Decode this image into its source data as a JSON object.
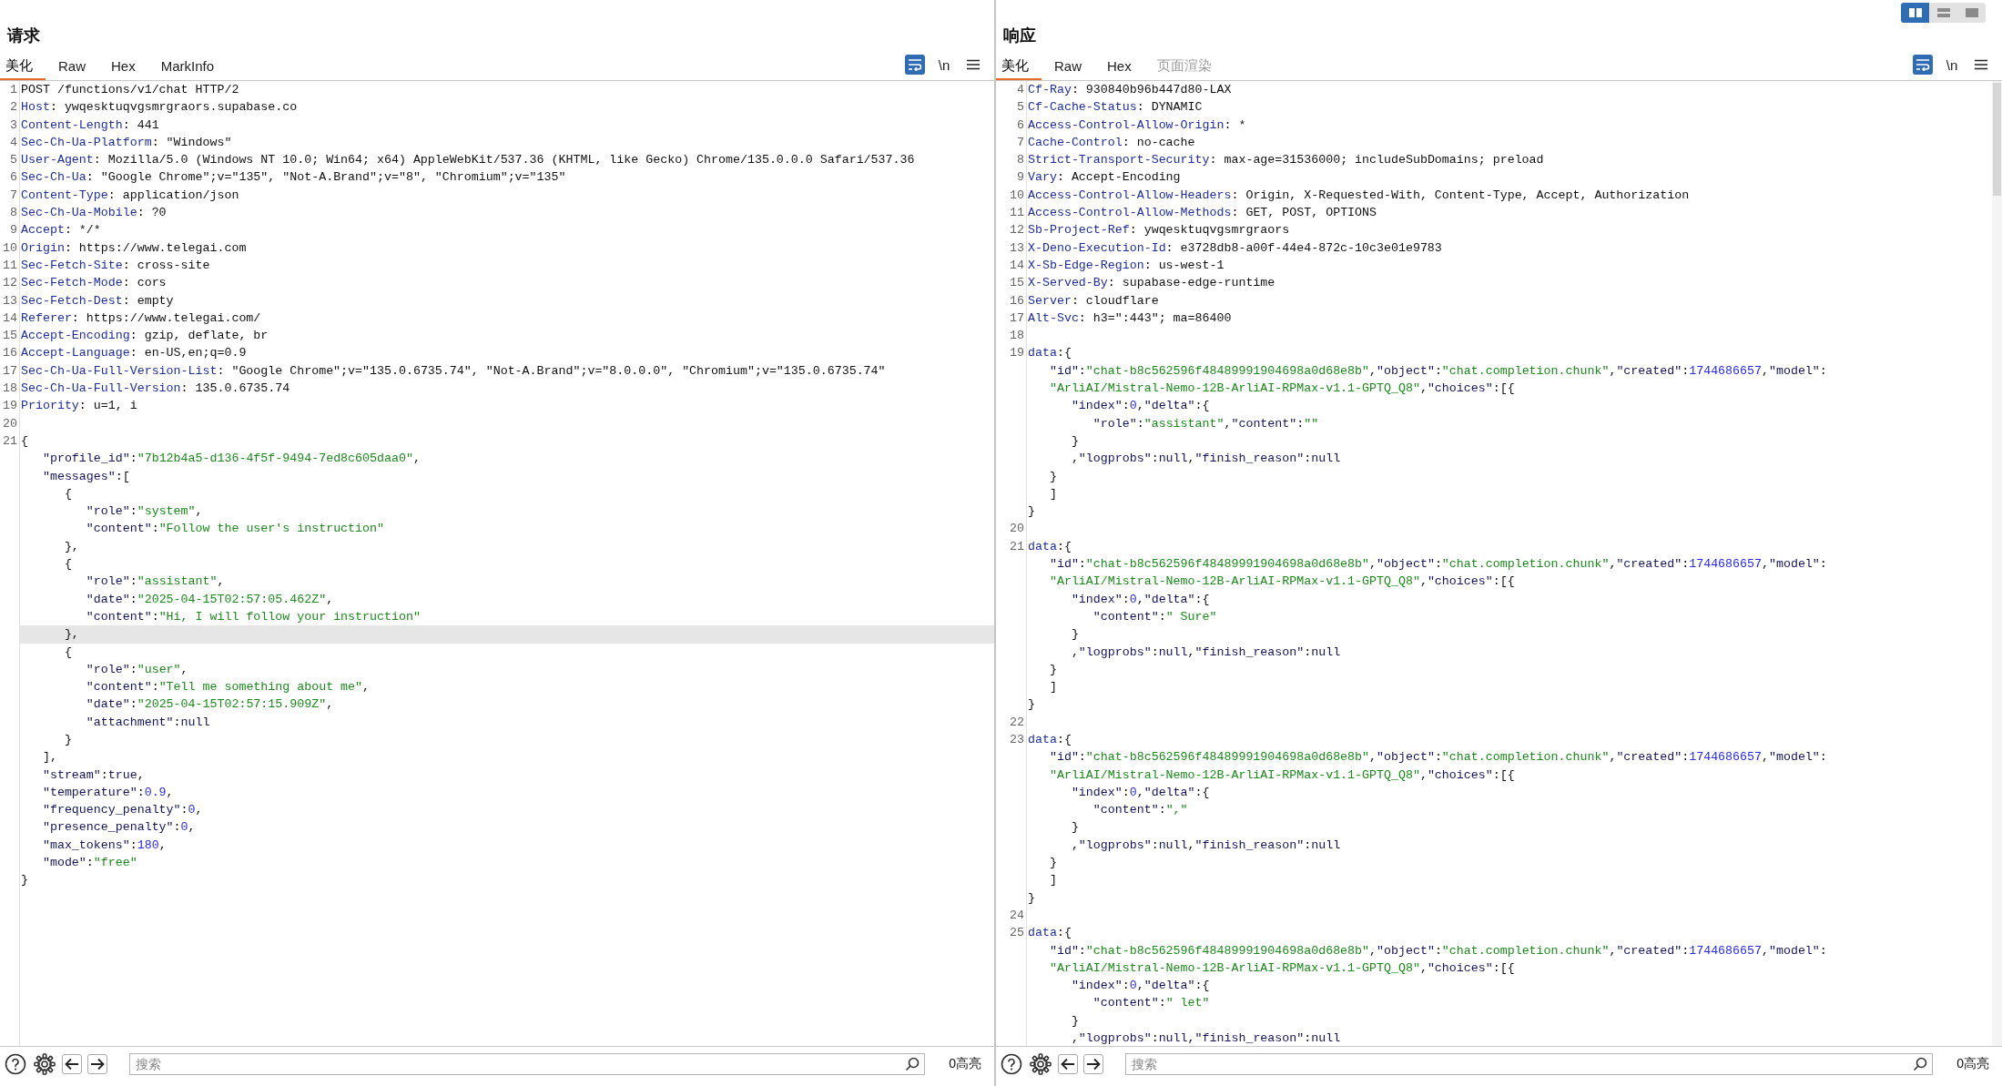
{
  "layout_switch": [
    {
      "kind": "columns",
      "selected": true
    },
    {
      "kind": "rows",
      "selected": false
    },
    {
      "kind": "single",
      "selected": false
    }
  ],
  "panes": [
    {
      "title": "请求",
      "tabs": [
        {
          "label": "美化",
          "selected": true,
          "disabled": false
        },
        {
          "label": "Raw",
          "selected": false,
          "disabled": false
        },
        {
          "label": "Hex",
          "selected": false,
          "disabled": false
        },
        {
          "label": "MarkInfo",
          "selected": false,
          "disabled": false
        }
      ],
      "toolbar": {
        "wrap_on": true,
        "newline_label": "\\n"
      },
      "lines": [
        {
          "number": "1",
          "highlighted": false,
          "tokens": [
            {
              "kind": "text",
              "text": "POST /functions/v1/chat HTTP/2"
            }
          ]
        },
        {
          "number": "2",
          "highlighted": false,
          "tokens": [
            {
              "kind": "name",
              "text": "Host"
            },
            {
              "kind": "text",
              "text": ": ywqesktuqvgsmrgraors.supabase.co"
            }
          ]
        },
        {
          "number": "3",
          "highlighted": false,
          "tokens": [
            {
              "kind": "name",
              "text": "Content-Length"
            },
            {
              "kind": "text",
              "text": ": 441"
            }
          ]
        },
        {
          "number": "4",
          "highlighted": false,
          "tokens": [
            {
              "kind": "name",
              "text": "Sec-Ch-Ua-Platform"
            },
            {
              "kind": "text",
              "text": ": \"Windows\""
            }
          ]
        },
        {
          "number": "5",
          "highlighted": false,
          "tokens": [
            {
              "kind": "name",
              "text": "User-Agent"
            },
            {
              "kind": "text",
              "text": ": Mozilla/5.0 (Windows NT 10.0; Win64; x64) AppleWebKit/537.36 (KHTML, like Gecko) Chrome/135.0.0.0 Safari/537.36"
            }
          ]
        },
        {
          "number": "6",
          "highlighted": false,
          "tokens": [
            {
              "kind": "name",
              "text": "Sec-Ch-Ua"
            },
            {
              "kind": "text",
              "text": ": \"Google Chrome\";v=\"135\", \"Not-A.Brand\";v=\"8\", \"Chromium\";v=\"135\""
            }
          ]
        },
        {
          "number": "7",
          "highlighted": false,
          "tokens": [
            {
              "kind": "name",
              "text": "Content-Type"
            },
            {
              "kind": "text",
              "text": ": application/json"
            }
          ]
        },
        {
          "number": "8",
          "highlighted": false,
          "tokens": [
            {
              "kind": "name",
              "text": "Sec-Ch-Ua-Mobile"
            },
            {
              "kind": "text",
              "text": ": ?0"
            }
          ]
        },
        {
          "number": "9",
          "highlighted": false,
          "tokens": [
            {
              "kind": "name",
              "text": "Accept"
            },
            {
              "kind": "text",
              "text": ": */*"
            }
          ]
        },
        {
          "number": "10",
          "highlighted": false,
          "tokens": [
            {
              "kind": "name",
              "text": "Origin"
            },
            {
              "kind": "text",
              "text": ": https://www.telegai.com"
            }
          ]
        },
        {
          "number": "11",
          "highlighted": false,
          "tokens": [
            {
              "kind": "name",
              "text": "Sec-Fetch-Site"
            },
            {
              "kind": "text",
              "text": ": cross-site"
            }
          ]
        },
        {
          "number": "12",
          "highlighted": false,
          "tokens": [
            {
              "kind": "name",
              "text": "Sec-Fetch-Mode"
            },
            {
              "kind": "text",
              "text": ": cors"
            }
          ]
        },
        {
          "number": "13",
          "highlighted": false,
          "tokens": [
            {
              "kind": "name",
              "text": "Sec-Fetch-Dest"
            },
            {
              "kind": "text",
              "text": ": empty"
            }
          ]
        },
        {
          "number": "14",
          "highlighted": false,
          "tokens": [
            {
              "kind": "name",
              "text": "Referer"
            },
            {
              "kind": "text",
              "text": ": https://www.telegai.com/"
            }
          ]
        },
        {
          "number": "15",
          "highlighted": false,
          "tokens": [
            {
              "kind": "name",
              "text": "Accept-Encoding"
            },
            {
              "kind": "text",
              "text": ": gzip, deflate, br"
            }
          ]
        },
        {
          "number": "16",
          "highlighted": false,
          "tokens": [
            {
              "kind": "name",
              "text": "Accept-Language"
            },
            {
              "kind": "text",
              "text": ": en-US,en;q=0.9"
            }
          ]
        },
        {
          "number": "17",
          "highlighted": false,
          "tokens": [
            {
              "kind": "name",
              "text": "Sec-Ch-Ua-Full-Version-List"
            },
            {
              "kind": "text",
              "text": ": \"Google Chrome\";v=\"135.0.6735.74\", \"Not-A.Brand\";v=\"8.0.0.0\", \"Chromium\";v=\"135.0.6735.74\""
            }
          ]
        },
        {
          "number": "18",
          "highlighted": false,
          "tokens": [
            {
              "kind": "name",
              "text": "Sec-Ch-Ua-Full-Version"
            },
            {
              "kind": "text",
              "text": ": 135.0.6735.74"
            }
          ]
        },
        {
          "number": "19",
          "highlighted": false,
          "tokens": [
            {
              "kind": "name",
              "text": "Priority"
            },
            {
              "kind": "text",
              "text": ": u=1, i"
            }
          ]
        },
        {
          "number": "20",
          "highlighted": false
        },
        {
          "number": "21",
          "highlighted": false,
          "tokens": [
            {
              "kind": "text",
              "text": "{"
            }
          ]
        },
        {
          "highlighted": false,
          "tokens": [
            {
              "kind": "prop",
              "text": "   \"profile_id\""
            },
            {
              "kind": "text",
              "text": ":"
            },
            {
              "kind": "str",
              "text": "\"7b12b4a5-d136-4f5f-9494-7ed8c605daa0\""
            },
            {
              "kind": "text",
              "text": ","
            }
          ]
        },
        {
          "highlighted": false,
          "tokens": [
            {
              "kind": "prop",
              "text": "   \"messages\""
            },
            {
              "kind": "text",
              "text": ":["
            }
          ]
        },
        {
          "highlighted": false,
          "tokens": [
            {
              "kind": "text",
              "text": "      {"
            }
          ]
        },
        {
          "highlighted": false,
          "tokens": [
            {
              "kind": "prop",
              "text": "         \"role\""
            },
            {
              "kind": "text",
              "text": ":"
            },
            {
              "kind": "str",
              "text": "\"system\""
            },
            {
              "kind": "text",
              "text": ","
            }
          ]
        },
        {
          "highlighted": false,
          "tokens": [
            {
              "kind": "prop",
              "text": "         \"content\""
            },
            {
              "kind": "text",
              "text": ":"
            },
            {
              "kind": "str",
              "text": "\"Follow the user's instruction\""
            }
          ]
        },
        {
          "highlighted": false,
          "tokens": [
            {
              "kind": "text",
              "text": "      },"
            }
          ]
        },
        {
          "highlighted": false,
          "tokens": [
            {
              "kind": "text",
              "text": "      {"
            }
          ]
        },
        {
          "highlighted": false,
          "tokens": [
            {
              "kind": "prop",
              "text": "         \"role\""
            },
            {
              "kind": "text",
              "text": ":"
            },
            {
              "kind": "str",
              "text": "\"assistant\""
            },
            {
              "kind": "text",
              "text": ","
            }
          ]
        },
        {
          "highlighted": false,
          "tokens": [
            {
              "kind": "prop",
              "text": "         \"date\""
            },
            {
              "kind": "text",
              "text": ":"
            },
            {
              "kind": "str",
              "text": "\"2025-04-15T02:57:05.462Z\""
            },
            {
              "kind": "text",
              "text": ","
            }
          ]
        },
        {
          "highlighted": false,
          "tokens": [
            {
              "kind": "prop",
              "text": "         \"content\""
            },
            {
              "kind": "text",
              "text": ":"
            },
            {
              "kind": "str",
              "text": "\"Hi, I will follow your instruction\""
            }
          ]
        },
        {
          "highlighted": true,
          "tokens": [
            {
              "kind": "text",
              "text": "      },"
            }
          ]
        },
        {
          "highlighted": false,
          "tokens": [
            {
              "kind": "text",
              "text": "      {"
            }
          ]
        },
        {
          "highlighted": false,
          "tokens": [
            {
              "kind": "prop",
              "text": "         \"role\""
            },
            {
              "kind": "text",
              "text": ":"
            },
            {
              "kind": "str",
              "text": "\"user\""
            },
            {
              "kind": "text",
              "text": ","
            }
          ]
        },
        {
          "highlighted": false,
          "tokens": [
            {
              "kind": "prop",
              "text": "         \"content\""
            },
            {
              "kind": "text",
              "text": ":"
            },
            {
              "kind": "str",
              "text": "\"Tell me something about me\""
            },
            {
              "kind": "text",
              "text": ","
            }
          ]
        },
        {
          "highlighted": false,
          "tokens": [
            {
              "kind": "prop",
              "text": "         \"date\""
            },
            {
              "kind": "text",
              "text": ":"
            },
            {
              "kind": "str",
              "text": "\"2025-04-15T02:57:15.909Z\""
            },
            {
              "kind": "text",
              "text": ","
            }
          ]
        },
        {
          "highlighted": false,
          "tokens": [
            {
              "kind": "prop",
              "text": "         \"attachment\""
            },
            {
              "kind": "text",
              "text": ":"
            },
            {
              "kind": "lit",
              "text": "null"
            }
          ]
        },
        {
          "highlighted": false,
          "tokens": [
            {
              "kind": "text",
              "text": "      }"
            }
          ]
        },
        {
          "highlighted": false,
          "tokens": [
            {
              "kind": "text",
              "text": "   ],"
            }
          ]
        },
        {
          "highlighted": false,
          "tokens": [
            {
              "kind": "prop",
              "text": "   \"stream\""
            },
            {
              "kind": "text",
              "text": ":"
            },
            {
              "kind": "lit",
              "text": "true"
            },
            {
              "kind": "text",
              "text": ","
            }
          ]
        },
        {
          "highlighted": false,
          "tokens": [
            {
              "kind": "prop",
              "text": "   \"temperature\""
            },
            {
              "kind": "text",
              "text": ":"
            },
            {
              "kind": "num",
              "text": "0.9"
            },
            {
              "kind": "text",
              "text": ","
            }
          ]
        },
        {
          "highlighted": false,
          "tokens": [
            {
              "kind": "prop",
              "text": "   \"frequency_penalty\""
            },
            {
              "kind": "text",
              "text": ":"
            },
            {
              "kind": "num",
              "text": "0"
            },
            {
              "kind": "text",
              "text": ","
            }
          ]
        },
        {
          "highlighted": false,
          "tokens": [
            {
              "kind": "prop",
              "text": "   \"presence_penalty\""
            },
            {
              "kind": "text",
              "text": ":"
            },
            {
              "kind": "num",
              "text": "0"
            },
            {
              "kind": "text",
              "text": ","
            }
          ]
        },
        {
          "highlighted": false,
          "tokens": [
            {
              "kind": "prop",
              "text": "   \"max_tokens\""
            },
            {
              "kind": "text",
              "text": ":"
            },
            {
              "kind": "num",
              "text": "180"
            },
            {
              "kind": "text",
              "text": ","
            }
          ]
        },
        {
          "highlighted": false,
          "tokens": [
            {
              "kind": "prop",
              "text": "   \"mode\""
            },
            {
              "kind": "text",
              "text": ":"
            },
            {
              "kind": "str",
              "text": "\"free\""
            }
          ]
        },
        {
          "highlighted": false,
          "tokens": [
            {
              "kind": "text",
              "text": "}"
            }
          ]
        }
      ],
      "search": {
        "placeholder": "搜索"
      },
      "highlight_count": "0高亮"
    },
    {
      "title": "响应",
      "tabs": [
        {
          "label": "美化",
          "selected": true,
          "disabled": false
        },
        {
          "label": "Raw",
          "selected": false,
          "disabled": false
        },
        {
          "label": "Hex",
          "selected": false,
          "disabled": false
        },
        {
          "label": "页面渲染",
          "selected": false,
          "disabled": true
        }
      ],
      "toolbar": {
        "wrap_on": true,
        "newline_label": "\\n"
      },
      "lines": [
        {
          "number": "4",
          "highlighted": false,
          "tokens": [
            {
              "kind": "name",
              "text": "Cf-Ray"
            },
            {
              "kind": "text",
              "text": ": 930840b96b447d80-LAX"
            }
          ]
        },
        {
          "number": "5",
          "highlighted": false,
          "tokens": [
            {
              "kind": "name",
              "text": "Cf-Cache-Status"
            },
            {
              "kind": "text",
              "text": ": DYNAMIC"
            }
          ]
        },
        {
          "number": "6",
          "highlighted": false,
          "tokens": [
            {
              "kind": "name",
              "text": "Access-Control-Allow-Origin"
            },
            {
              "kind": "text",
              "text": ": *"
            }
          ]
        },
        {
          "number": "7",
          "highlighted": false,
          "tokens": [
            {
              "kind": "name",
              "text": "Cache-Control"
            },
            {
              "kind": "text",
              "text": ": no-cache"
            }
          ]
        },
        {
          "number": "8",
          "highlighted": false,
          "tokens": [
            {
              "kind": "name",
              "text": "Strict-Transport-Security"
            },
            {
              "kind": "text",
              "text": ": max-age=31536000; includeSubDomains; preload"
            }
          ]
        },
        {
          "number": "9",
          "highlighted": false,
          "tokens": [
            {
              "kind": "name",
              "text": "Vary"
            },
            {
              "kind": "text",
              "text": ": Accept-Encoding"
            }
          ]
        },
        {
          "number": "10",
          "highlighted": false,
          "tokens": [
            {
              "kind": "name",
              "text": "Access-Control-Allow-Headers"
            },
            {
              "kind": "text",
              "text": ": Origin, X-Requested-With, Content-Type, Accept, Authorization"
            }
          ]
        },
        {
          "number": "11",
          "highlighted": false,
          "tokens": [
            {
              "kind": "name",
              "text": "Access-Control-Allow-Methods"
            },
            {
              "kind": "text",
              "text": ": GET, POST, OPTIONS"
            }
          ]
        },
        {
          "number": "12",
          "highlighted": false,
          "tokens": [
            {
              "kind": "name",
              "text": "Sb-Project-Ref"
            },
            {
              "kind": "text",
              "text": ": ywqesktuqvgsmrgraors"
            }
          ]
        },
        {
          "number": "13",
          "highlighted": false,
          "tokens": [
            {
              "kind": "name",
              "text": "X-Deno-Execution-Id"
            },
            {
              "kind": "text",
              "text": ": e3728db8-a00f-44e4-872c-10c3e01e9783"
            }
          ]
        },
        {
          "number": "14",
          "highlighted": false,
          "tokens": [
            {
              "kind": "name",
              "text": "X-Sb-Edge-Region"
            },
            {
              "kind": "text",
              "text": ": us-west-1"
            }
          ]
        },
        {
          "number": "15",
          "highlighted": false,
          "tokens": [
            {
              "kind": "name",
              "text": "X-Served-By"
            },
            {
              "kind": "text",
              "text": ": supabase-edge-runtime"
            }
          ]
        },
        {
          "number": "16",
          "highlighted": false,
          "tokens": [
            {
              "kind": "name",
              "text": "Server"
            },
            {
              "kind": "text",
              "text": ": cloudflare"
            }
          ]
        },
        {
          "number": "17",
          "highlighted": false,
          "tokens": [
            {
              "kind": "name",
              "text": "Alt-Svc"
            },
            {
              "kind": "text",
              "text": ": h3=\":443\"; ma=86400"
            }
          ]
        },
        {
          "number": "18",
          "highlighted": false
        },
        {
          "number": "19",
          "highlighted": false,
          "tokens": [
            {
              "kind": "name",
              "text": "data"
            },
            {
              "kind": "text",
              "text": ":{"
            }
          ]
        },
        {
          "highlighted": false,
          "tokens": [
            {
              "kind": "prop",
              "text": "   \"id\""
            },
            {
              "kind": "text",
              "text": ":"
            },
            {
              "kind": "str",
              "text": "\"chat-b8c562596f48489991904698a0d68e8b\""
            },
            {
              "kind": "text",
              "text": ","
            },
            {
              "kind": "prop",
              "text": "\"object\""
            },
            {
              "kind": "text",
              "text": ":"
            },
            {
              "kind": "str",
              "text": "\"chat.completion.chunk\""
            },
            {
              "kind": "text",
              "text": ","
            },
            {
              "kind": "prop",
              "text": "\"created\""
            },
            {
              "kind": "text",
              "text": ":"
            },
            {
              "kind": "num",
              "text": "1744686657"
            },
            {
              "kind": "text",
              "text": ","
            },
            {
              "kind": "prop",
              "text": "\"model\""
            },
            {
              "kind": "text",
              "text": ":"
            }
          ]
        },
        {
          "highlighted": false,
          "tokens": [
            {
              "kind": "str",
              "text": "   \"ArliAI/Mistral-Nemo-12B-ArliAI-RPMax-v1.1-GPTQ_Q8\""
            },
            {
              "kind": "text",
              "text": ","
            },
            {
              "kind": "prop",
              "text": "\"choices\""
            },
            {
              "kind": "text",
              "text": ":[{"
            }
          ]
        },
        {
          "highlighted": false,
          "tokens": [
            {
              "kind": "prop",
              "text": "      \"index\""
            },
            {
              "kind": "text",
              "text": ":"
            },
            {
              "kind": "num",
              "text": "0"
            },
            {
              "kind": "text",
              "text": ","
            },
            {
              "kind": "prop",
              "text": "\"delta\""
            },
            {
              "kind": "text",
              "text": ":{"
            }
          ]
        },
        {
          "highlighted": false,
          "tokens": [
            {
              "kind": "prop",
              "text": "         \"role\""
            },
            {
              "kind": "text",
              "text": ":"
            },
            {
              "kind": "str",
              "text": "\"assistant\""
            },
            {
              "kind": "text",
              "text": ","
            },
            {
              "kind": "prop",
              "text": "\"content\""
            },
            {
              "kind": "text",
              "text": ":"
            },
            {
              "kind": "str",
              "text": "\"\""
            }
          ]
        },
        {
          "highlighted": false,
          "tokens": [
            {
              "kind": "text",
              "text": "      }"
            }
          ]
        },
        {
          "highlighted": false,
          "tokens": [
            {
              "kind": "text",
              "text": "      ,"
            },
            {
              "kind": "prop",
              "text": "\"logprobs\""
            },
            {
              "kind": "text",
              "text": ":"
            },
            {
              "kind": "lit",
              "text": "null"
            },
            {
              "kind": "text",
              "text": ","
            },
            {
              "kind": "prop",
              "text": "\"finish_reason\""
            },
            {
              "kind": "text",
              "text": ":"
            },
            {
              "kind": "lit",
              "text": "null"
            }
          ]
        },
        {
          "highlighted": false,
          "tokens": [
            {
              "kind": "text",
              "text": "   }"
            }
          ]
        },
        {
          "highlighted": false,
          "tokens": [
            {
              "kind": "text",
              "text": "   ]"
            }
          ]
        },
        {
          "highlighted": false,
          "tokens": [
            {
              "kind": "text",
              "text": "}"
            }
          ]
        },
        {
          "number": "20",
          "highlighted": false
        },
        {
          "number": "21",
          "highlighted": false,
          "tokens": [
            {
              "kind": "name",
              "text": "data"
            },
            {
              "kind": "text",
              "text": ":{"
            }
          ]
        },
        {
          "highlighted": false,
          "tokens": [
            {
              "kind": "prop",
              "text": "   \"id\""
            },
            {
              "kind": "text",
              "text": ":"
            },
            {
              "kind": "str",
              "text": "\"chat-b8c562596f48489991904698a0d68e8b\""
            },
            {
              "kind": "text",
              "text": ","
            },
            {
              "kind": "prop",
              "text": "\"object\""
            },
            {
              "kind": "text",
              "text": ":"
            },
            {
              "kind": "str",
              "text": "\"chat.completion.chunk\""
            },
            {
              "kind": "text",
              "text": ","
            },
            {
              "kind": "prop",
              "text": "\"created\""
            },
            {
              "kind": "text",
              "text": ":"
            },
            {
              "kind": "num",
              "text": "1744686657"
            },
            {
              "kind": "text",
              "text": ","
            },
            {
              "kind": "prop",
              "text": "\"model\""
            },
            {
              "kind": "text",
              "text": ":"
            }
          ]
        },
        {
          "highlighted": false,
          "tokens": [
            {
              "kind": "str",
              "text": "   \"ArliAI/Mistral-Nemo-12B-ArliAI-RPMax-v1.1-GPTQ_Q8\""
            },
            {
              "kind": "text",
              "text": ","
            },
            {
              "kind": "prop",
              "text": "\"choices\""
            },
            {
              "kind": "text",
              "text": ":[{"
            }
          ]
        },
        {
          "highlighted": false,
          "tokens": [
            {
              "kind": "prop",
              "text": "      \"index\""
            },
            {
              "kind": "text",
              "text": ":"
            },
            {
              "kind": "num",
              "text": "0"
            },
            {
              "kind": "text",
              "text": ","
            },
            {
              "kind": "prop",
              "text": "\"delta\""
            },
            {
              "kind": "text",
              "text": ":{"
            }
          ]
        },
        {
          "highlighted": false,
          "tokens": [
            {
              "kind": "prop",
              "text": "         \"content\""
            },
            {
              "kind": "text",
              "text": ":"
            },
            {
              "kind": "str",
              "text": "\" Sure\""
            }
          ]
        },
        {
          "highlighted": false,
          "tokens": [
            {
              "kind": "text",
              "text": "      }"
            }
          ]
        },
        {
          "highlighted": false,
          "tokens": [
            {
              "kind": "text",
              "text": "      ,"
            },
            {
              "kind": "prop",
              "text": "\"logprobs\""
            },
            {
              "kind": "text",
              "text": ":"
            },
            {
              "kind": "lit",
              "text": "null"
            },
            {
              "kind": "text",
              "text": ","
            },
            {
              "kind": "prop",
              "text": "\"finish_reason\""
            },
            {
              "kind": "text",
              "text": ":"
            },
            {
              "kind": "lit",
              "text": "null"
            }
          ]
        },
        {
          "highlighted": false,
          "tokens": [
            {
              "kind": "text",
              "text": "   }"
            }
          ]
        },
        {
          "highlighted": false,
          "tokens": [
            {
              "kind": "text",
              "text": "   ]"
            }
          ]
        },
        {
          "highlighted": false,
          "tokens": [
            {
              "kind": "text",
              "text": "}"
            }
          ]
        },
        {
          "number": "22",
          "highlighted": false
        },
        {
          "number": "23",
          "highlighted": false,
          "tokens": [
            {
              "kind": "name",
              "text": "data"
            },
            {
              "kind": "text",
              "text": ":{"
            }
          ]
        },
        {
          "highlighted": false,
          "tokens": [
            {
              "kind": "prop",
              "text": "   \"id\""
            },
            {
              "kind": "text",
              "text": ":"
            },
            {
              "kind": "str",
              "text": "\"chat-b8c562596f48489991904698a0d68e8b\""
            },
            {
              "kind": "text",
              "text": ","
            },
            {
              "kind": "prop",
              "text": "\"object\""
            },
            {
              "kind": "text",
              "text": ":"
            },
            {
              "kind": "str",
              "text": "\"chat.completion.chunk\""
            },
            {
              "kind": "text",
              "text": ","
            },
            {
              "kind": "prop",
              "text": "\"created\""
            },
            {
              "kind": "text",
              "text": ":"
            },
            {
              "kind": "num",
              "text": "1744686657"
            },
            {
              "kind": "text",
              "text": ","
            },
            {
              "kind": "prop",
              "text": "\"model\""
            },
            {
              "kind": "text",
              "text": ":"
            }
          ]
        },
        {
          "highlighted": false,
          "tokens": [
            {
              "kind": "str",
              "text": "   \"ArliAI/Mistral-Nemo-12B-ArliAI-RPMax-v1.1-GPTQ_Q8\""
            },
            {
              "kind": "text",
              "text": ","
            },
            {
              "kind": "prop",
              "text": "\"choices\""
            },
            {
              "kind": "text",
              "text": ":[{"
            }
          ]
        },
        {
          "highlighted": false,
          "tokens": [
            {
              "kind": "prop",
              "text": "      \"index\""
            },
            {
              "kind": "text",
              "text": ":"
            },
            {
              "kind": "num",
              "text": "0"
            },
            {
              "kind": "text",
              "text": ","
            },
            {
              "kind": "prop",
              "text": "\"delta\""
            },
            {
              "kind": "text",
              "text": ":{"
            }
          ]
        },
        {
          "highlighted": false,
          "tokens": [
            {
              "kind": "prop",
              "text": "         \"content\""
            },
            {
              "kind": "text",
              "text": ":"
            },
            {
              "kind": "str",
              "text": "\",\""
            }
          ]
        },
        {
          "highlighted": false,
          "tokens": [
            {
              "kind": "text",
              "text": "      }"
            }
          ]
        },
        {
          "highlighted": false,
          "tokens": [
            {
              "kind": "text",
              "text": "      ,"
            },
            {
              "kind": "prop",
              "text": "\"logprobs\""
            },
            {
              "kind": "text",
              "text": ":"
            },
            {
              "kind": "lit",
              "text": "null"
            },
            {
              "kind": "text",
              "text": ","
            },
            {
              "kind": "prop",
              "text": "\"finish_reason\""
            },
            {
              "kind": "text",
              "text": ":"
            },
            {
              "kind": "lit",
              "text": "null"
            }
          ]
        },
        {
          "highlighted": false,
          "tokens": [
            {
              "kind": "text",
              "text": "   }"
            }
          ]
        },
        {
          "highlighted": false,
          "tokens": [
            {
              "kind": "text",
              "text": "   ]"
            }
          ]
        },
        {
          "highlighted": false,
          "tokens": [
            {
              "kind": "text",
              "text": "}"
            }
          ]
        },
        {
          "number": "24",
          "highlighted": false
        },
        {
          "number": "25",
          "highlighted": false,
          "tokens": [
            {
              "kind": "name",
              "text": "data"
            },
            {
              "kind": "text",
              "text": ":{"
            }
          ]
        },
        {
          "highlighted": false,
          "tokens": [
            {
              "kind": "prop",
              "text": "   \"id\""
            },
            {
              "kind": "text",
              "text": ":"
            },
            {
              "kind": "str",
              "text": "\"chat-b8c562596f48489991904698a0d68e8b\""
            },
            {
              "kind": "text",
              "text": ","
            },
            {
              "kind": "prop",
              "text": "\"object\""
            },
            {
              "kind": "text",
              "text": ":"
            },
            {
              "kind": "str",
              "text": "\"chat.completion.chunk\""
            },
            {
              "kind": "text",
              "text": ","
            },
            {
              "kind": "prop",
              "text": "\"created\""
            },
            {
              "kind": "text",
              "text": ":"
            },
            {
              "kind": "num",
              "text": "1744686657"
            },
            {
              "kind": "text",
              "text": ","
            },
            {
              "kind": "prop",
              "text": "\"model\""
            },
            {
              "kind": "text",
              "text": ":"
            }
          ]
        },
        {
          "highlighted": false,
          "tokens": [
            {
              "kind": "str",
              "text": "   \"ArliAI/Mistral-Nemo-12B-ArliAI-RPMax-v1.1-GPTQ_Q8\""
            },
            {
              "kind": "text",
              "text": ","
            },
            {
              "kind": "prop",
              "text": "\"choices\""
            },
            {
              "kind": "text",
              "text": ":[{"
            }
          ]
        },
        {
          "highlighted": false,
          "tokens": [
            {
              "kind": "prop",
              "text": "      \"index\""
            },
            {
              "kind": "text",
              "text": ":"
            },
            {
              "kind": "num",
              "text": "0"
            },
            {
              "kind": "text",
              "text": ","
            },
            {
              "kind": "prop",
              "text": "\"delta\""
            },
            {
              "kind": "text",
              "text": ":{"
            }
          ]
        },
        {
          "highlighted": false,
          "tokens": [
            {
              "kind": "prop",
              "text": "         \"content\""
            },
            {
              "kind": "text",
              "text": ":"
            },
            {
              "kind": "str",
              "text": "\" let\""
            }
          ]
        },
        {
          "highlighted": false,
          "tokens": [
            {
              "kind": "text",
              "text": "      }"
            }
          ]
        },
        {
          "highlighted": false,
          "tokens": [
            {
              "kind": "text",
              "text": "      ,"
            },
            {
              "kind": "prop",
              "text": "\"logprobs\""
            },
            {
              "kind": "text",
              "text": ":"
            },
            {
              "kind": "lit",
              "text": "null"
            },
            {
              "kind": "text",
              "text": ","
            },
            {
              "kind": "prop",
              "text": "\"finish_reason\""
            },
            {
              "kind": "text",
              "text": ":"
            },
            {
              "kind": "lit",
              "text": "null"
            }
          ]
        }
      ],
      "search": {
        "placeholder": "搜索"
      },
      "highlight_count": "0高亮"
    }
  ]
}
